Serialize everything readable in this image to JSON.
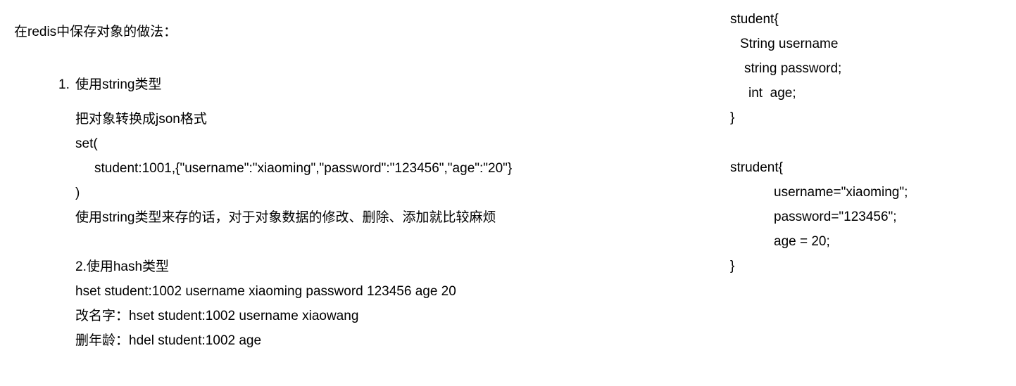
{
  "document": {
    "title_line": "在redis中保存对象的做法：",
    "list": [
      {
        "marker": "1.",
        "text": "使用string类型"
      }
    ],
    "string_section": {
      "note": "把对象转换成json格式",
      "set_open": "set(",
      "set_arg": "student:1001,{\"username\":\"xiaoming\",\"password\":\"123456\",\"age\":\"20\"}",
      "set_close": ")",
      "summary": "使用string类型来存的话，对于对象数据的修改、删除、添加就比较麻烦"
    },
    "hash_section": {
      "heading": "2.使用hash类型",
      "hset_command": "hset student:1002 username xiaoming password 123456 age 20",
      "rename_line": "改名字：hset student:1002 username xiaowang",
      "delete_age_line": "删年龄：hdel student:1002 age"
    },
    "class_definition": {
      "open": "student{",
      "field_username": "String username",
      "field_password": "string password;",
      "field_age": "int  age;",
      "close": "}"
    },
    "instance_definition": {
      "open": "strudent{",
      "assign_username": "username=\"xiaoming\";",
      "assign_password": "password=\"123456\";",
      "assign_age": "age = 20;",
      "close": "}"
    }
  },
  "colors": {
    "text": "#000000",
    "background": "#ffffff"
  }
}
